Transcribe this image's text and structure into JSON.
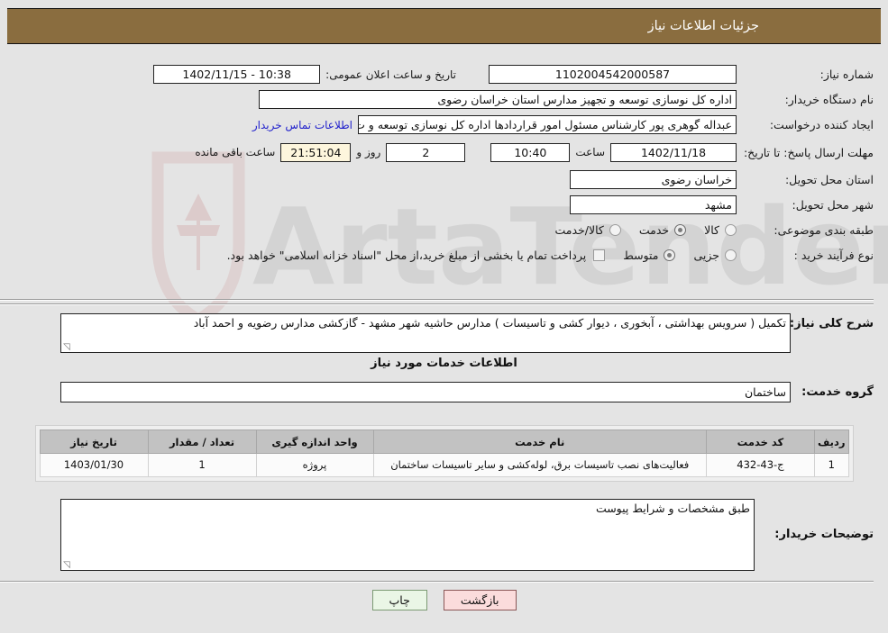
{
  "header": {
    "title": "جزئیات اطلاعات نیاز",
    "bg_color": "#8a6d3f"
  },
  "fields": {
    "need_number_label": "شماره نیاز:",
    "need_number_value": "1102004542000587",
    "announce_label": "تاریخ و ساعت اعلان عمومی:",
    "announce_value": "10:38 - 1402/11/15",
    "buyer_org_label": "نام دستگاه خریدار:",
    "buyer_org_value": "اداره کل نوسازی  توسعه و تجهیز مدارس استان خراسان رضوی",
    "creator_label": "ایجاد کننده درخواست:",
    "creator_value": "عبداله گوهری پور کارشناس مسئول امور قراردادها  اداره کل نوسازی  توسعه و ت",
    "contact_link": "اطلاعات تماس خریدار",
    "deadline_label": "مهلت ارسال پاسخ: تا تاریخ:",
    "deadline_date": "1402/11/18",
    "hour_label": "ساعت",
    "deadline_time": "10:40",
    "days_remaining": "2",
    "days_label": "روز و",
    "time_remaining": "21:51:04",
    "remaining_label": "ساعت باقی مانده",
    "province_label": "استان محل تحویل:",
    "province_value": "خراسان رضوی",
    "city_label": "شهر محل تحویل:",
    "city_value": "مشهد",
    "category_label": "طبقه بندی موضوعی:",
    "category_options": [
      {
        "label": "کالا",
        "selected": false
      },
      {
        "label": "خدمت",
        "selected": true
      },
      {
        "label": "کالا/خدمت",
        "selected": false
      }
    ],
    "process_label": "نوع فرآیند خرید :",
    "process_options": [
      {
        "label": "جزیی",
        "selected": false
      },
      {
        "label": "متوسط",
        "selected": true
      }
    ],
    "payment_checked": false,
    "payment_text": "پرداخت تمام یا بخشی از مبلغ خرید،از محل \"اسناد خزانه اسلامی\" خواهد بود."
  },
  "description": {
    "label": "شرح کلی نیاز:",
    "value": "تکمیل ( سرویس بهداشتی ، آبخوری ، دیوار کشی و تاسیسات ) مدارس حاشیه شهر مشهد - گازکشی مدارس رضویه و احمد آباد"
  },
  "services_section": {
    "title": "اطلاعات خدمات مورد نیاز",
    "group_label": "گروه خدمت:",
    "group_value": "ساختمان"
  },
  "table": {
    "headers": [
      "ردیف",
      "کد خدمت",
      "نام خدمت",
      "واحد اندازه گیری",
      "تعداد / مقدار",
      "تاریخ نیاز"
    ],
    "rows": [
      {
        "index": "1",
        "code": "ج-43-432",
        "name": "فعالیت‌های نصب تاسیسات برق، لوله‌کشی و سایر تاسیسات ساختمان",
        "unit": "پروژه",
        "quantity": "1",
        "need_date": "1403/01/30"
      }
    ]
  },
  "buyer_notes": {
    "label": "توضیحات خریدار:",
    "value": "طبق مشخصات و شرایط پیوست"
  },
  "buttons": {
    "print": "چاپ",
    "back": "بازگشت"
  },
  "watermark": {
    "text": "ArtaTender.net"
  }
}
